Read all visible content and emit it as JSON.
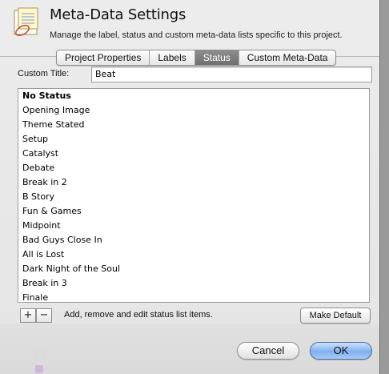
{
  "dialog": {
    "title": "Meta-Data Settings",
    "subtitle": "Manage the label, status and custom meta-data lists specific to this project."
  },
  "tabs": [
    {
      "label": "Project Properties",
      "active": false
    },
    {
      "label": "Labels",
      "active": false
    },
    {
      "label": "Status",
      "active": true
    },
    {
      "label": "Custom Meta-Data",
      "active": false
    }
  ],
  "custom_title": {
    "label": "Custom Title:",
    "value": "Beat"
  },
  "status_list": [
    "No Status",
    "Opening Image",
    "Theme Stated",
    "Setup",
    "Catalyst",
    "Debate",
    "Break in 2",
    "B Story",
    "Fun & Games",
    "Midpoint",
    "Bad Guys Close In",
    "All is Lost",
    "Dark Night of the Soul",
    "Break in 3",
    "Finale"
  ],
  "list_controls": {
    "add_symbol": "+",
    "remove_symbol": "−",
    "helper_text": "Add, remove and edit status list items.",
    "make_default_label": "Make Default"
  },
  "footer": {
    "cancel_label": "Cancel",
    "ok_label": "OK"
  },
  "icons": {
    "app_icon": "index-card-icon"
  },
  "colors": {
    "accent_ok": "#7fb0ee",
    "active_tab": "#7a7a7a"
  }
}
